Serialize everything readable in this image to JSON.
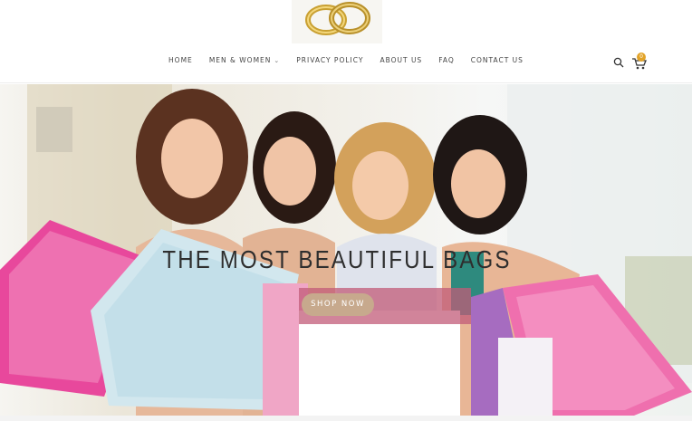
{
  "header": {
    "logo_icon": "wedding-rings-logo",
    "nav": [
      {
        "label": "HOME",
        "has_dropdown": false
      },
      {
        "label": "MEN & WOMEN",
        "has_dropdown": true
      },
      {
        "label": "PRIVACY POLICY",
        "has_dropdown": false
      },
      {
        "label": "ABOUT US",
        "has_dropdown": false
      },
      {
        "label": "FAQ",
        "has_dropdown": false
      },
      {
        "label": "CONTACT US",
        "has_dropdown": false
      }
    ],
    "search_icon": "search-icon",
    "cart_icon": "cart-icon",
    "cart_count": "0"
  },
  "hero": {
    "title": "THE MOST BEAUTIFUL BAGS",
    "button_label": "SHOP NOW",
    "image_icon": "women-with-shopping-bags-image"
  },
  "colors": {
    "accent": "#e2a328",
    "button": "#c7a98d",
    "text": "#2e2e2e"
  }
}
